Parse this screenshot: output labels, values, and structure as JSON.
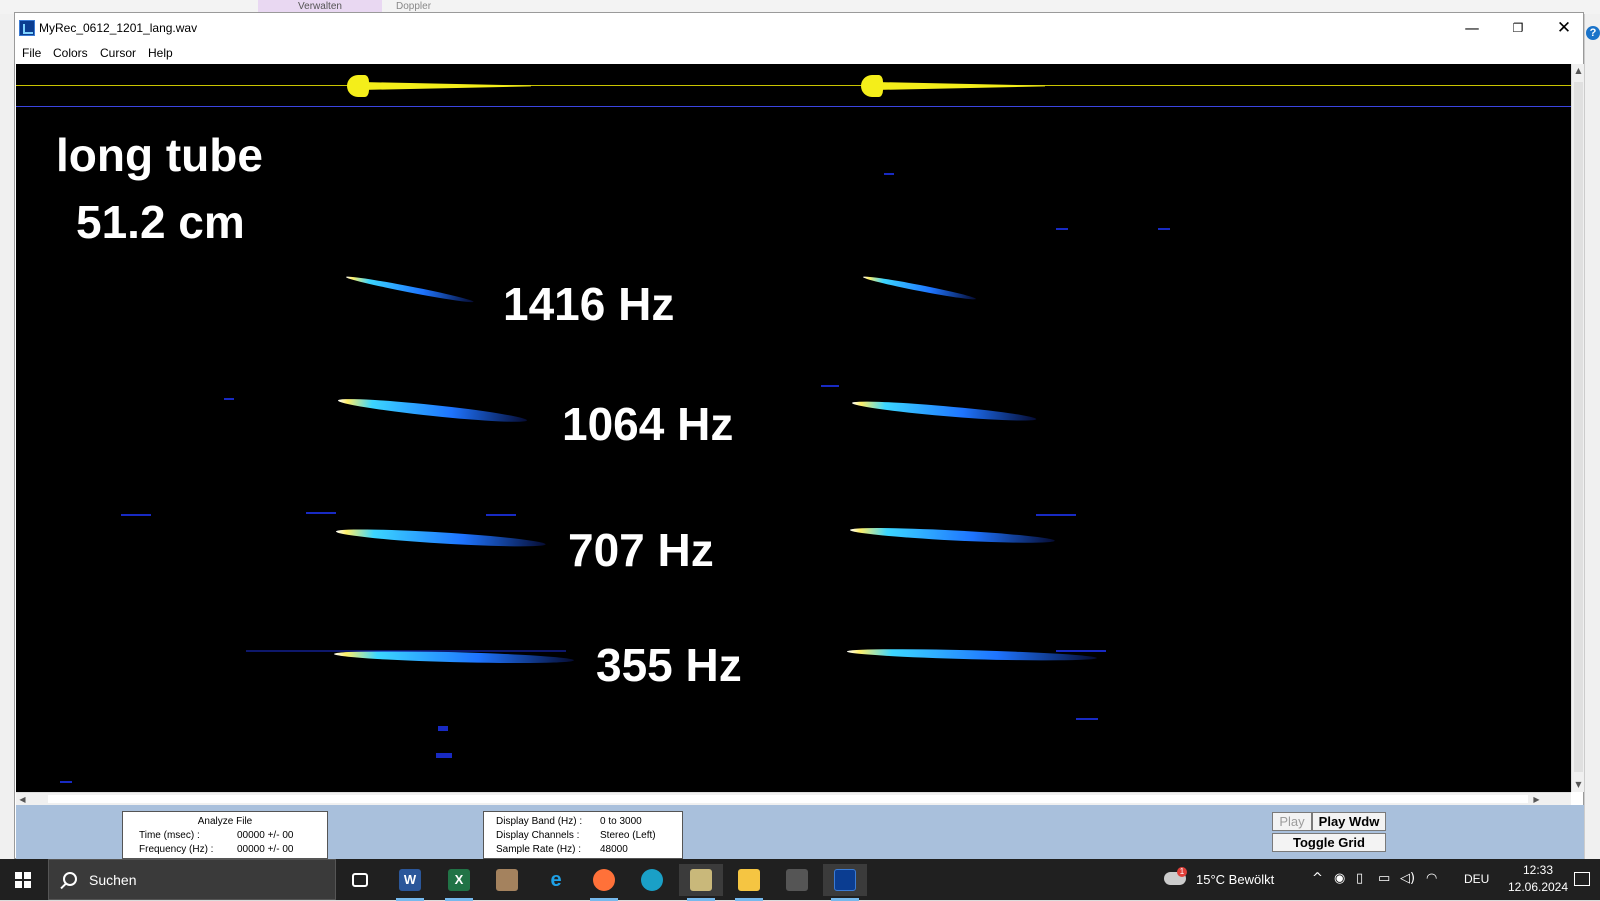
{
  "background": {
    "tab_1": "Verwalten",
    "tab_2": "Doppler"
  },
  "window": {
    "title": "MyRec_0612_1201_lang.wav",
    "minimize_glyph": "—",
    "maximize_glyph": "❐",
    "close_glyph": "✕"
  },
  "menu": {
    "items": [
      "File",
      "Colors",
      "Cursor",
      "Help"
    ]
  },
  "spectrogram": {
    "title_line_1": "long tube",
    "title_line_2": "51.2 cm",
    "labels": [
      "1416 Hz",
      "1064 Hz",
      "707 Hz",
      "355 Hz"
    ],
    "colors": {
      "background": "#000000",
      "waveform": "#f4ee1a",
      "separator": "#3b45e0"
    }
  },
  "analyze": {
    "title": "Analyze File",
    "time_label": "Time (msec) :",
    "time_value": "00000 +/- 00",
    "freq_label": "Frequency (Hz) :",
    "freq_value": "00000 +/- 00"
  },
  "display": {
    "band_label": "Display Band (Hz) :",
    "band_value": "0 to 3000",
    "channels_label": "Display Channels :",
    "channels_value": "Stereo (Left)",
    "rate_label": "Sample Rate (Hz) :",
    "rate_value": "48000"
  },
  "controls": {
    "play": "Play",
    "play_window": "Play Wdw",
    "toggle_grid": "Toggle Grid"
  },
  "taskbar": {
    "search_placeholder": "Suchen",
    "apps": [
      "task-view",
      "word",
      "excel",
      "app-tool",
      "internet-explorer",
      "firefox",
      "edge",
      "photo-app",
      "file-explorer",
      "media-app",
      "spectrogram-app"
    ],
    "weather_temp": "15°C",
    "weather_desc": "Bewölkt",
    "weather_alert": "1",
    "language": "DEU",
    "time": "12:33",
    "date": "12.06.2024"
  }
}
